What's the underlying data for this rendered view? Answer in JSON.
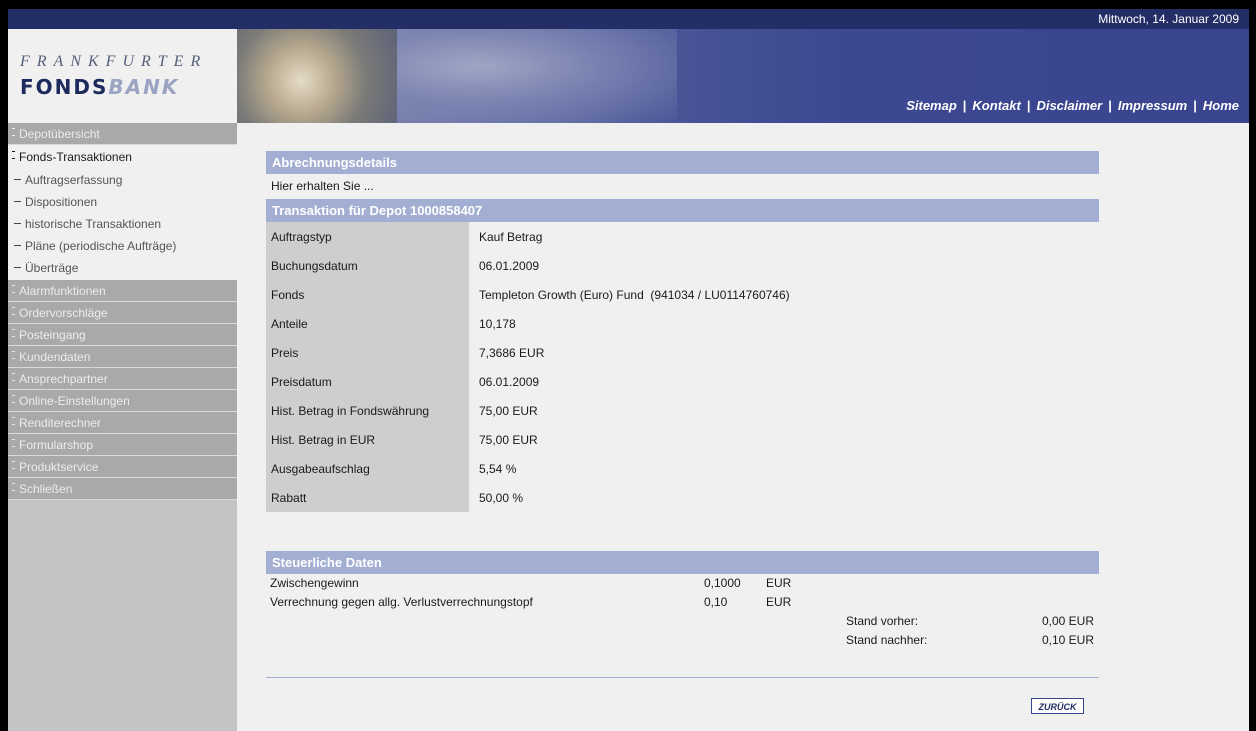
{
  "header": {
    "date": "Mittwoch, 14. Januar 2009",
    "logo_line1": "FRANKFURTER",
    "logo_line2a": "FONDS",
    "logo_line2b": "BANK",
    "nav": [
      "Sitemap",
      "Kontakt",
      "Disclaimer",
      "Impressum",
      "Home"
    ]
  },
  "sidebar": {
    "items": [
      {
        "label": "Depotübersicht",
        "active": false
      },
      {
        "label": "Fonds-Transaktionen",
        "active": true
      },
      {
        "label": "Alarmfunktionen",
        "active": false
      },
      {
        "label": "Ordervorschläge",
        "active": false
      },
      {
        "label": "Posteingang",
        "active": false
      },
      {
        "label": "Kundendaten",
        "active": false
      },
      {
        "label": "Ansprechpartner",
        "active": false
      },
      {
        "label": "Online-Einstellungen",
        "active": false
      },
      {
        "label": "Renditerechner",
        "active": false
      },
      {
        "label": "Formularshop",
        "active": false
      },
      {
        "label": "Produktservice",
        "active": false
      },
      {
        "label": "Schließen",
        "active": false
      }
    ],
    "subitems": [
      "Auftragserfassung",
      "Dispositionen",
      "historische Transaktionen",
      "Pläne (periodische Aufträge)",
      "Überträge"
    ]
  },
  "main": {
    "details_title": "Abrechnungsdetails",
    "intro": "Hier erhalten Sie ...",
    "transaction_title": "Transaktion für Depot 1000858407",
    "rows": [
      {
        "k": "Auftragstyp",
        "v": "Kauf Betrag"
      },
      {
        "k": "Buchungsdatum",
        "v": "06.01.2009"
      },
      {
        "k": "Fonds",
        "v": "Templeton Growth (Euro) Fund  (941034 / LU0114760746)"
      },
      {
        "k": "Anteile",
        "v": "10,178"
      },
      {
        "k": "Preis",
        "v": "7,3686 EUR"
      },
      {
        "k": "Preisdatum",
        "v": "06.01.2009"
      },
      {
        "k": "Hist. Betrag in Fondswährung",
        "v": "75,00 EUR"
      },
      {
        "k": "Hist. Betrag in EUR",
        "v": "75,00 EUR"
      },
      {
        "k": "Ausgabeaufschlag",
        "v": "5,54 %"
      },
      {
        "k": "Rabatt",
        "v": "50,00 %"
      }
    ],
    "tax_title": "Steuerliche Daten",
    "tax": {
      "zw_label": "Zwischengewinn",
      "zw_value": "0,1000",
      "zw_cur": "EUR",
      "vr_label": "Verrechnung gegen allg. Verlustverrechnungstopf",
      "vr_value": "0,10",
      "vr_cur": "EUR",
      "sv_label": "Stand vorher:",
      "sv_value": "0,00 EUR",
      "sn_label": "Stand nachher:",
      "sn_value": "0,10 EUR"
    },
    "back_label": "ZURÜCK"
  }
}
